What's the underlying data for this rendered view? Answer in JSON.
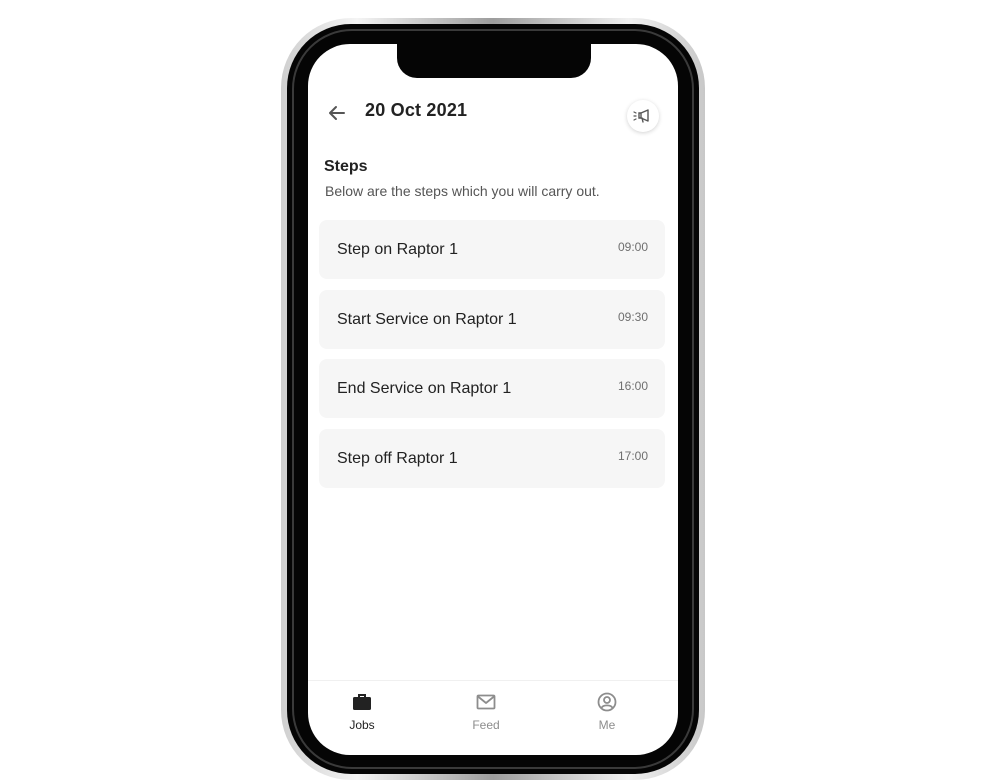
{
  "header": {
    "title": "20 Oct 2021",
    "back_icon": "arrow-left-icon",
    "announce_icon": "megaphone-icon"
  },
  "steps_section": {
    "title": "Steps",
    "subtitle": "Below are the steps which you will carry out.",
    "items": [
      {
        "label": "Step on Raptor 1",
        "time": "09:00"
      },
      {
        "label": "Start Service on Raptor 1",
        "time": "09:30"
      },
      {
        "label": "End Service on Raptor 1",
        "time": "16:00"
      },
      {
        "label": "Step off Raptor 1",
        "time": "17:00"
      }
    ]
  },
  "bottom_nav": {
    "items": [
      {
        "label": "Jobs",
        "icon": "briefcase-icon",
        "active": true
      },
      {
        "label": "Feed",
        "icon": "envelope-icon",
        "active": false
      },
      {
        "label": "Me",
        "icon": "user-circle-icon",
        "active": false
      }
    ]
  },
  "colors": {
    "card_background": "#f6f6f6",
    "text_primary": "#222222",
    "text_secondary": "#555555",
    "nav_inactive": "#8d8d8d"
  }
}
